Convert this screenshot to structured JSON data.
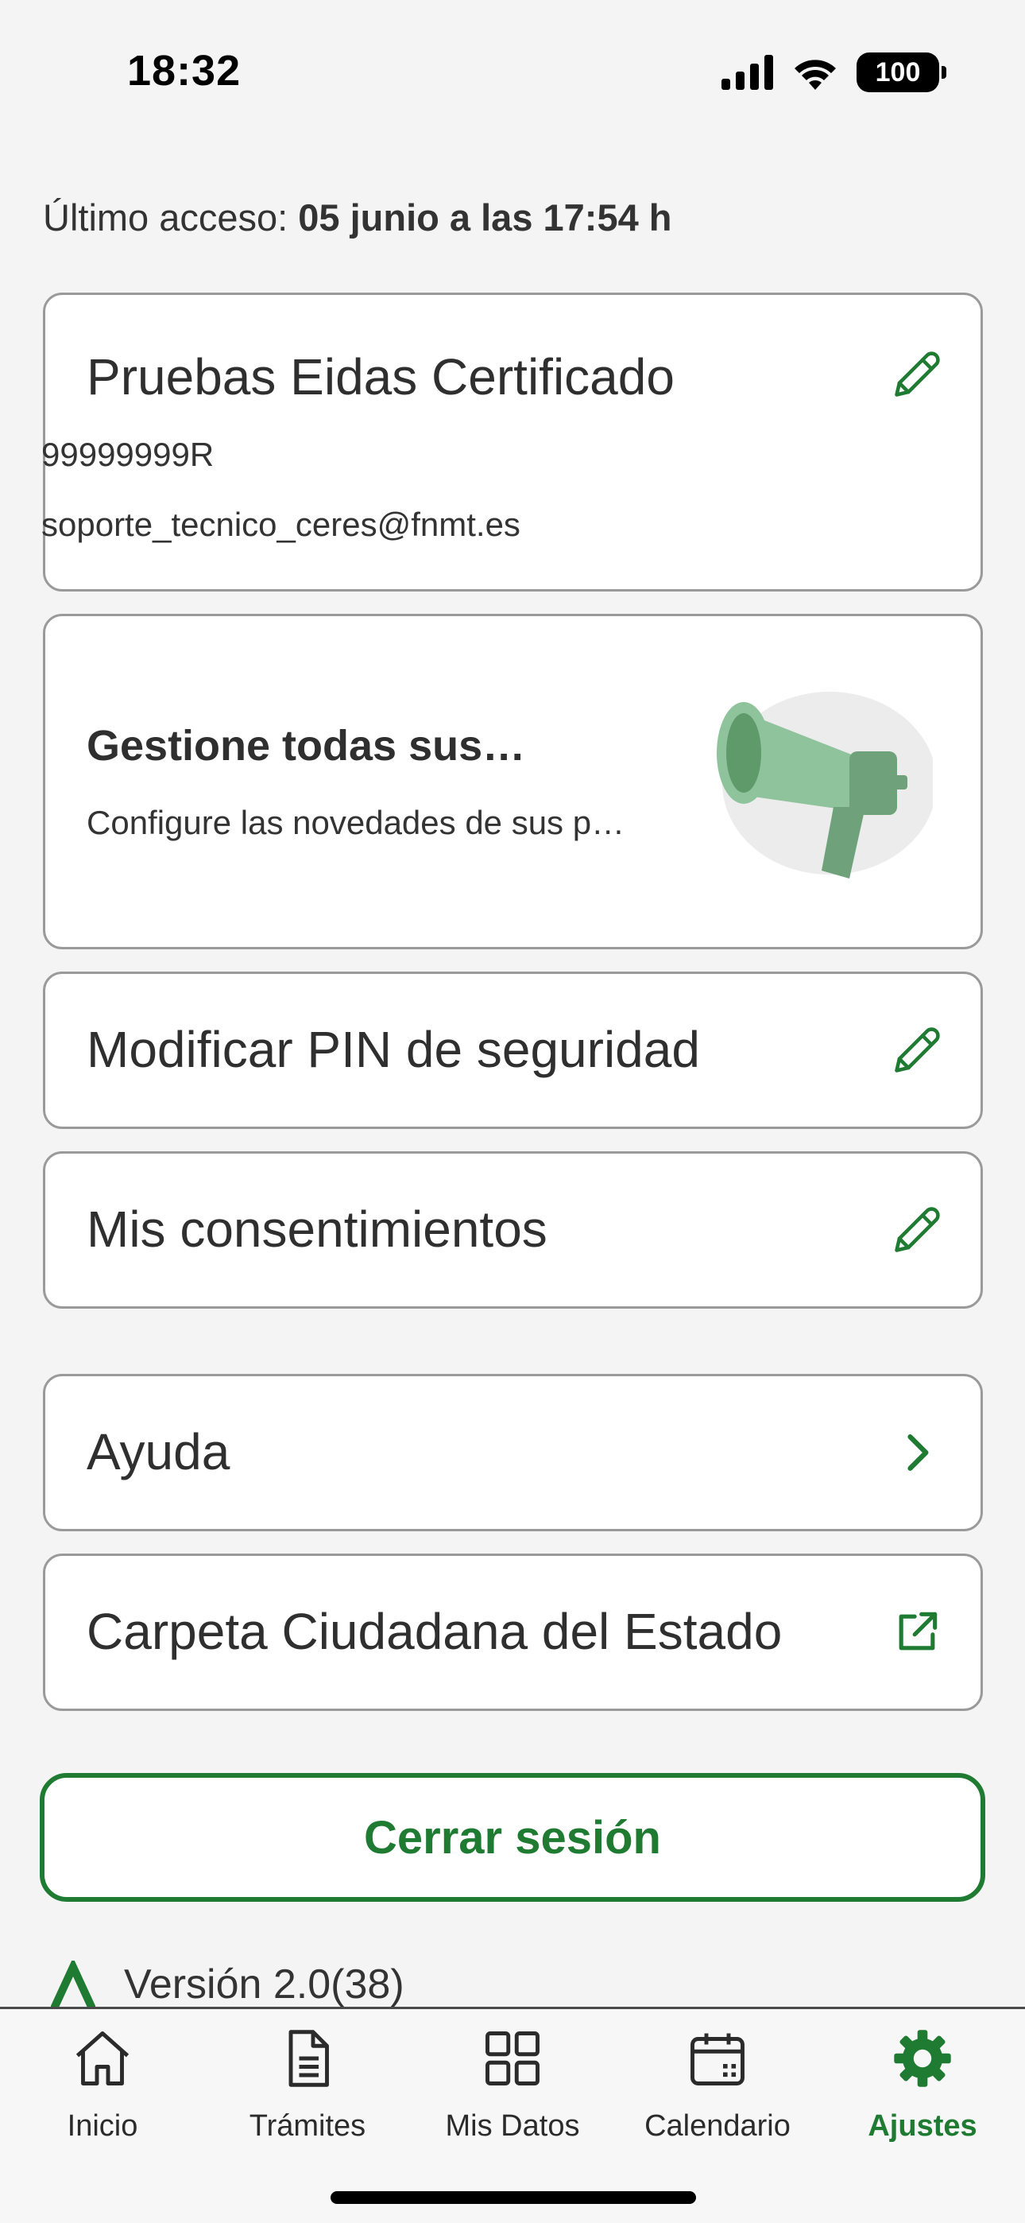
{
  "status_bar": {
    "time": "18:32",
    "battery": "100",
    "icons": [
      "signal-icon",
      "wifi-icon",
      "battery-icon"
    ]
  },
  "last_access": {
    "label": "Último acceso: ",
    "value": "05 junio a las 17:54 h"
  },
  "profile": {
    "name": "Pruebas Eidas Certificado",
    "id": "99999999R",
    "email": "soporte_tecnico_ceres@fnmt.es",
    "icon": "pencil-icon"
  },
  "promo": {
    "title": "Gestione todas sus…",
    "subtitle": "Configure las novedades de sus p…",
    "icon": "megaphone-icon"
  },
  "menu": {
    "pin": "Modificar PIN de seguridad",
    "consents": "Mis consentimientos",
    "help": "Ayuda",
    "carpeta": "Carpeta Ciudadana del Estado"
  },
  "logout_label": "Cerrar sesión",
  "version": "Versión 2.0(38)",
  "tabs": [
    {
      "label": "Inicio",
      "icon": "home-icon"
    },
    {
      "label": "Trámites",
      "icon": "document-icon"
    },
    {
      "label": "Mis Datos",
      "icon": "grid-icon"
    },
    {
      "label": "Calendario",
      "icon": "calendar-icon"
    },
    {
      "label": "Ajustes",
      "icon": "gear-icon",
      "active": true
    }
  ],
  "colors": {
    "accent": "#1f7a32",
    "background": "#f4f4f4",
    "border": "#9a9a9a"
  }
}
